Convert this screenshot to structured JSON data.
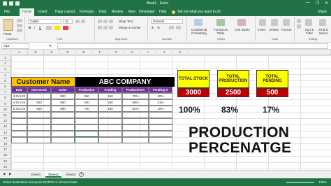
{
  "window": {
    "title": "Book1 - Excel",
    "controls": [
      "—",
      "❐",
      "✕"
    ]
  },
  "tabs": [
    "File",
    "Home",
    "Insert",
    "Page Layout",
    "Formulas",
    "Data",
    "Review",
    "View",
    "Developer",
    "Help"
  ],
  "tell_me": "Tell me what you want to do",
  "share_label": "Share",
  "ribbon": {
    "clipboard": {
      "label": "Clipboard",
      "paste": "Paste"
    },
    "font": {
      "label": "Font",
      "name": "Calibri",
      "size": "11"
    },
    "alignment": {
      "label": "Alignment",
      "wrap": "Wrap Text",
      "merge": "Merge & Center"
    },
    "number": {
      "label": "Number",
      "format": "General"
    },
    "styles": {
      "label": "Styles",
      "conditional": "Conditional Formatting",
      "format_table": "Format as Table",
      "cell_styles": "Cell Styles"
    },
    "cells": {
      "label": "Cells",
      "insert": "Insert",
      "delete": "Delete",
      "format": "Format"
    },
    "editing": {
      "label": "Editing",
      "sort": "Sort & Filter",
      "find": "Find & Select"
    }
  },
  "formula_bar": {
    "name_box": "O14",
    "fx": "fx",
    "value": ""
  },
  "columns": [
    "A",
    "B",
    "C",
    "D",
    "E",
    "F",
    "G",
    "H",
    "I",
    "J",
    "K"
  ],
  "rows": [
    "1",
    "2",
    "3",
    "4",
    "5",
    "6",
    "7",
    "8",
    "9",
    "10",
    "11",
    "12",
    "13",
    "14",
    "15",
    "16",
    "17",
    "18",
    "19",
    "20"
  ],
  "banner": {
    "customer": "Customer Name",
    "company": "ABC COMPANY"
  },
  "table": {
    "headers": [
      "Date",
      "New Stock",
      "Order",
      "Production",
      "Pending",
      "Production%",
      "Pending %"
    ],
    "rows": [
      [
        "3-Oct-22",
        "",
        "500",
        "350",
        "150",
        "70%",
        "30%"
      ],
      [
        "4-Oct-22",
        "500",
        "650",
        "450",
        "200",
        "69%",
        "31%"
      ],
      [
        "5-Oct-22",
        "600",
        "850",
        "700",
        "150",
        "82%",
        "18%"
      ]
    ]
  },
  "kpis": [
    {
      "label": "TOTAL STOCK",
      "value": "3000",
      "percent": "100%"
    },
    {
      "label": "TOTAL PRODUCTION",
      "value": "2500",
      "percent": "83%"
    },
    {
      "label": "TOTAL PENDING",
      "value": "500",
      "percent": "17%"
    }
  ],
  "big_title": {
    "line1": "PRODUCTION",
    "line2": "PERCENATGE"
  },
  "sheets": [
    "Sheet1",
    "Sheet2",
    "Sheet3"
  ],
  "active_sheet": "Sheet2",
  "status": {
    "message": "Select destination and press ENTER or choose Paste",
    "zoom": "100%"
  },
  "colors": {
    "excel_green": "#217346",
    "banner_gold": "#ffc000",
    "header_purple": "#7030a0",
    "kpi_yellow": "#ffff00",
    "kpi_red": "#c00000"
  }
}
